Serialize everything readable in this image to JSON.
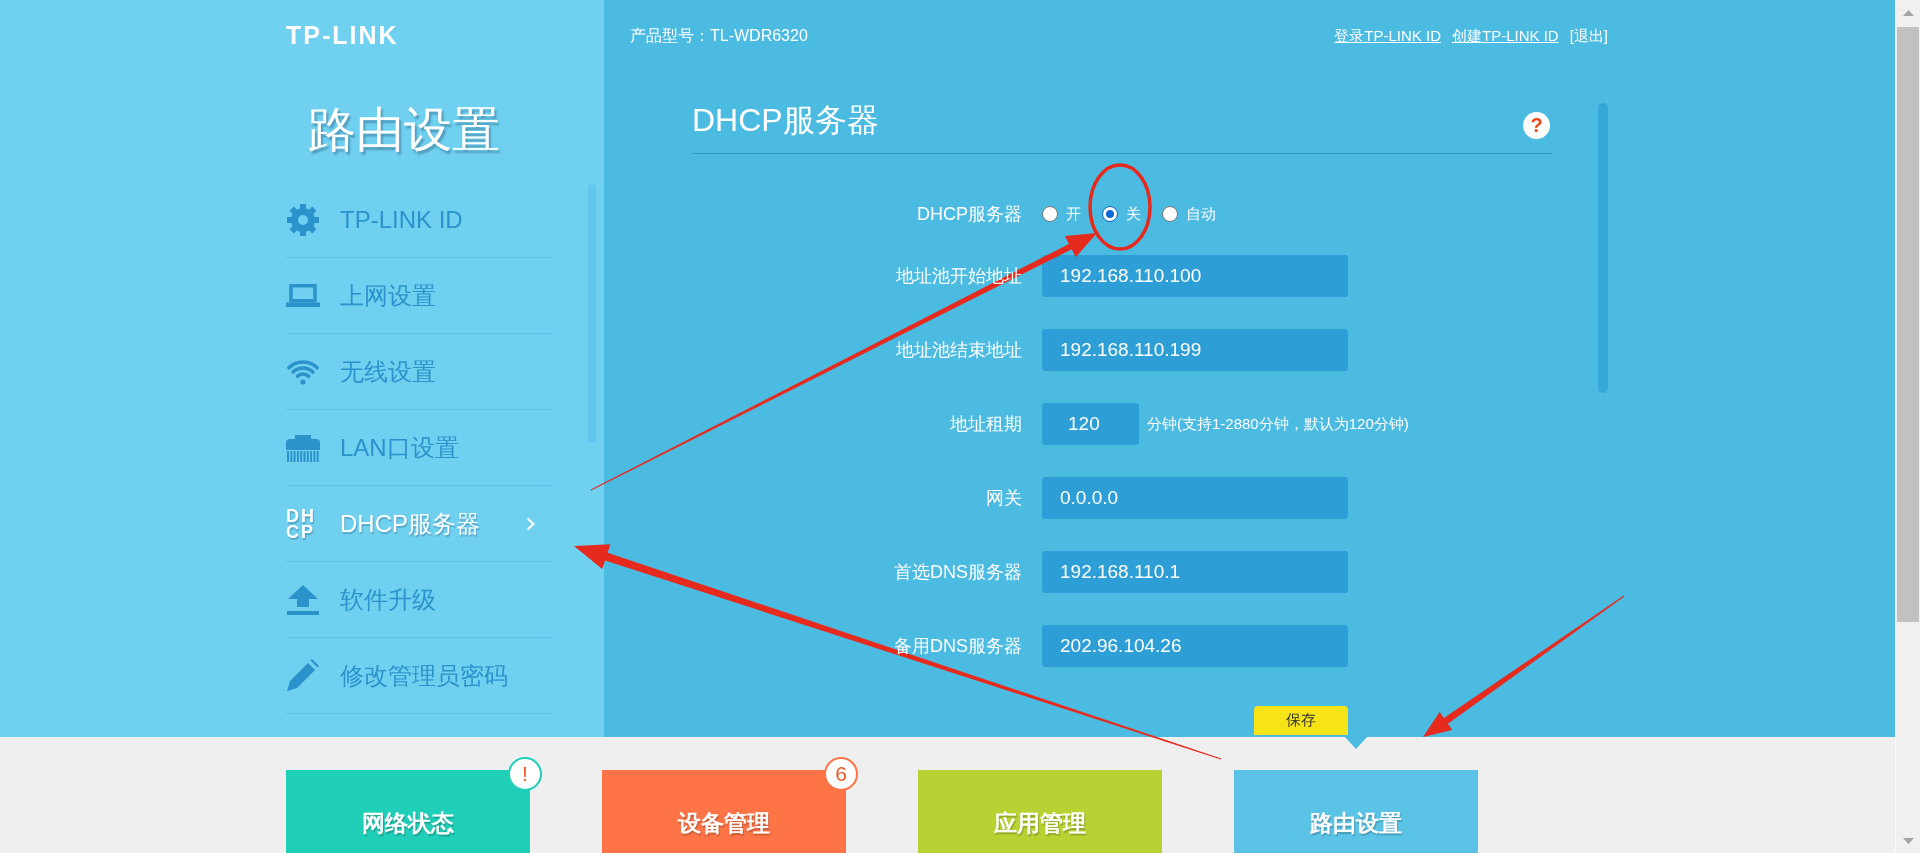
{
  "sidebar": {
    "logo": "TP-LINK",
    "title": "路由设置",
    "items": [
      {
        "label": "TP-LINK ID",
        "selected": false
      },
      {
        "label": "上网设置",
        "selected": false
      },
      {
        "label": "无线设置",
        "selected": false
      },
      {
        "label": "LAN口设置",
        "selected": false
      },
      {
        "icon_text": [
          "DH",
          "CP"
        ],
        "label": "DHCP服务器",
        "selected": true
      },
      {
        "label": "软件升级",
        "selected": false
      },
      {
        "label": "修改管理员密码",
        "selected": false
      }
    ]
  },
  "header": {
    "product_model": "产品型号：TL-WDR6320",
    "links": [
      {
        "label": "登录TP-LINK ID",
        "underlined": true
      },
      {
        "label": "创建TP-LINK ID",
        "underlined": true
      },
      {
        "label": "[退出]",
        "underlined": false
      }
    ]
  },
  "panel": {
    "title": "DHCP服务器",
    "help": "?",
    "rows": [
      {
        "kind": "radio",
        "label": "DHCP服务器",
        "options": [
          {
            "label": "开",
            "selected": false
          },
          {
            "label": "关",
            "selected": true
          },
          {
            "label": "自动",
            "selected": false
          }
        ]
      },
      {
        "kind": "input",
        "label": "地址池开始地址",
        "value": "192.168.110.100"
      },
      {
        "kind": "input",
        "label": "地址池结束地址",
        "value": "192.168.110.199"
      },
      {
        "kind": "short_input",
        "label": "地址租期",
        "value": "120",
        "hint": "分钟(支持1-2880分钟，默认为120分钟)"
      },
      {
        "kind": "input",
        "label": "网关",
        "value": "0.0.0.0"
      },
      {
        "kind": "input",
        "label": "首选DNS服务器",
        "value": "192.168.110.1"
      },
      {
        "kind": "input",
        "label": "备用DNS服务器",
        "value": "202.96.104.26"
      }
    ],
    "save_button": "保存"
  },
  "nav_tiles": [
    {
      "label": "网络状态",
      "color": "#1fcfb8",
      "badge": "!",
      "selected": false
    },
    {
      "label": "设备管理",
      "color": "#fe7446",
      "badge": "6",
      "selected": false
    },
    {
      "label": "应用管理",
      "color": "#b6d233",
      "selected": false
    },
    {
      "label": "路由设置",
      "color": "#5bc4e6",
      "selected": true
    }
  ]
}
